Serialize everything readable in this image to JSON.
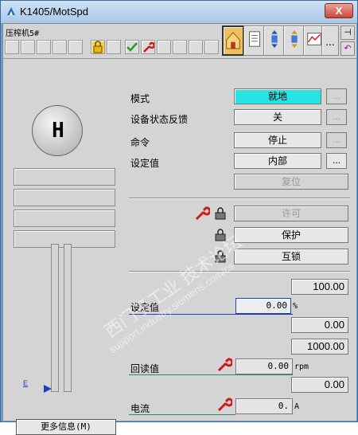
{
  "window": {
    "title": "K1405/MotSpd",
    "close_label": "X"
  },
  "toolbar": {
    "device_label": "压榨机5#",
    "more_label": "...",
    "pin_label": "⊣",
    "back_label": "↶"
  },
  "left": {
    "scale_marker": "E",
    "more_info_label": "更多信息(M)"
  },
  "controls": {
    "mode": {
      "label": "模式",
      "value": "就地",
      "more": "..."
    },
    "feedback": {
      "label": "设备状态反馈",
      "value": "关",
      "more": "..."
    },
    "command": {
      "label": "命令",
      "value": "停止",
      "more": "..."
    },
    "setpoint_src": {
      "label": "设定值",
      "value": "内部",
      "more": "..."
    },
    "reset": {
      "label": "复位"
    },
    "permit": {
      "label": "许可"
    },
    "protect": {
      "label": "保护"
    },
    "interlock": {
      "label": "互锁"
    }
  },
  "analog": {
    "sp_high": "100.00",
    "setpoint": {
      "label": "设定值",
      "value": "0.00",
      "unit": "%"
    },
    "sp_low": "0.00",
    "pv_high": "1000.00",
    "readback": {
      "label": "回读值",
      "value": "0.00",
      "unit": "rpm"
    },
    "pv_low": "0.00",
    "current": {
      "label": "电流",
      "value": "0.",
      "unit": "A"
    }
  },
  "watermark": {
    "line1": "西门子工业 技术论坛",
    "line2": "support.industry.siemens.com/cs"
  },
  "colors": {
    "mode_active": "#27e4e4",
    "setpoint_border": "#1d3fb8",
    "readback_line": "#2a8a70",
    "wrench": "#d01818"
  }
}
